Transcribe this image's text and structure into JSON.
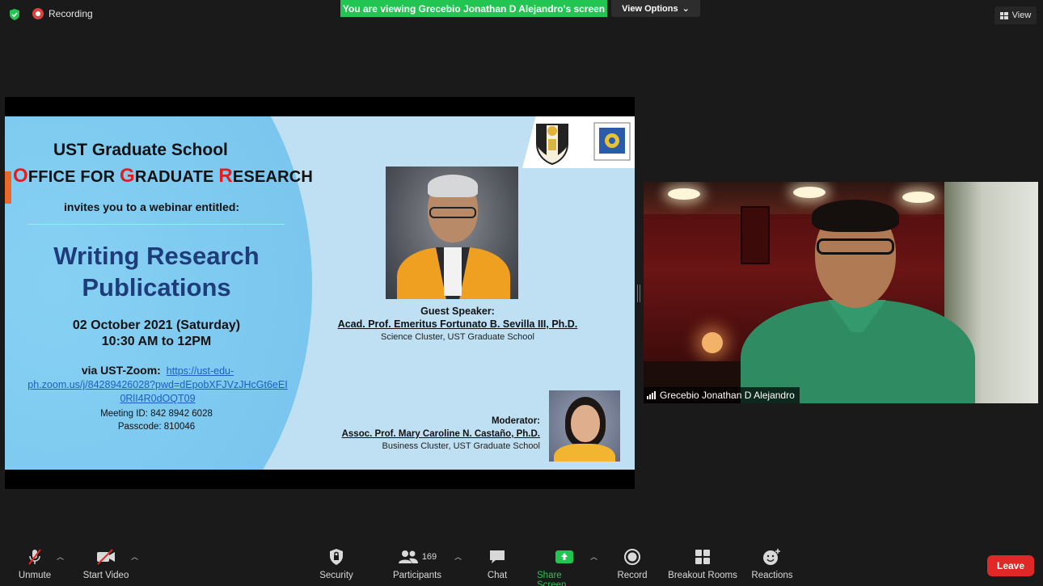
{
  "topbar": {
    "recording_label": "Recording",
    "viewing_banner": "You are viewing Grecebio Jonathan D Alejandro's screen",
    "view_options_label": "View Options",
    "view_label": "View"
  },
  "slide": {
    "title": "UST Graduate School",
    "office": {
      "o_cap": "O",
      "o_rest": "FFICE FOR ",
      "g_cap": "G",
      "g_rest": "RADUATE ",
      "r_cap": "R",
      "r_rest": "ESEARCH"
    },
    "invite": "invites you to a webinar entitled:",
    "webinar_line1": "Writing Research",
    "webinar_line2": "Publications",
    "date": "02 October 2021 (Saturday)",
    "time": "10:30 AM to 12PM",
    "via_label": "via UST-Zoom:",
    "link_line1": "https://ust-edu-",
    "link_line2": "ph.zoom.us/j/84289426028?pwd=dEpobXFJVzJHcGt6eEI",
    "link_line3": "0RlI4R0dOQT09",
    "meeting_id": "Meeting ID: 842 8942 6028",
    "passcode": "Passcode: 810046",
    "guest_label": "Guest Speaker:",
    "guest_name": "Acad. Prof. Emeritus Fortunato B. Sevilla III, Ph.D.",
    "guest_affiliation": "Science Cluster, UST Graduate School",
    "moderator_label": "Moderator:",
    "moderator_name": "Assoc. Prof. Mary Caroline N. Castaño, Ph.D.",
    "moderator_affiliation": "Business Cluster, UST Graduate School"
  },
  "video": {
    "participant_name": "Grecebio Jonathan D Alejandro"
  },
  "toolbar": {
    "unmute": "Unmute",
    "start_video": "Start Video",
    "security": "Security",
    "participants": "Participants",
    "participants_count": "169",
    "chat": "Chat",
    "share_screen": "Share Screen",
    "record": "Record",
    "breakout_rooms": "Breakout Rooms",
    "reactions": "Reactions",
    "leave": "Leave"
  },
  "colors": {
    "banner_green": "#23c552",
    "leave_red": "#e02828",
    "title_blue": "#1f3c7a",
    "office_red": "#e02020"
  }
}
